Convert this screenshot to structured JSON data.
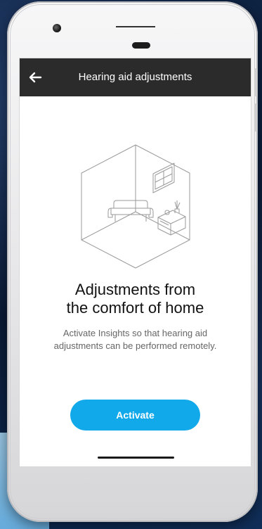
{
  "app": {
    "title": "Hearing aid adjustments"
  },
  "content": {
    "headline": "Adjustments from\nthe comfort of home",
    "subtext": "Activate Insights so that hearing aid\nadjustments can be performed remotely.",
    "activate_label": "Activate"
  },
  "icons": {
    "back": "arrow-left-icon",
    "illustration": "room-illustration"
  },
  "colors": {
    "accent": "#12a9ea",
    "appbar": "#2b2b2b"
  }
}
